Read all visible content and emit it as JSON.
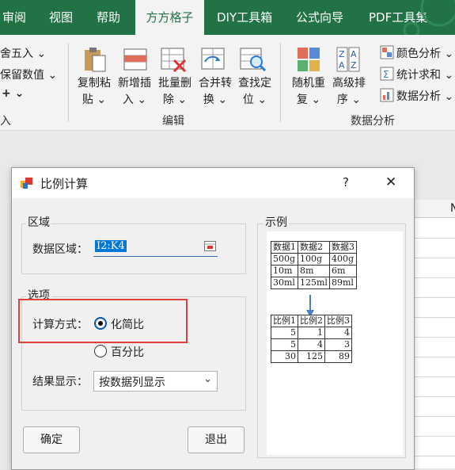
{
  "ribbon_tabs": [
    "审阅",
    "视图",
    "帮助",
    "方方格子",
    "DIY工具箱",
    "公式向导",
    "PDF工具集"
  ],
  "active_tab": "方方格子",
  "ribbon_left": {
    "row1": "舍五入",
    "row2": "保留数值",
    "row3": "+",
    "group": "入"
  },
  "edit_group": {
    "name": "编辑",
    "buttons": [
      {
        "l1": "复制粘",
        "l2": "贴"
      },
      {
        "l1": "新增插",
        "l2": "入"
      },
      {
        "l1": "批量删",
        "l2": "除"
      },
      {
        "l1": "合并转",
        "l2": "换"
      },
      {
        "l1": "查找定",
        "l2": "位"
      }
    ]
  },
  "analysis_group": {
    "name": "数据分析",
    "buttons": [
      {
        "l1": "随机重",
        "l2": "复"
      },
      {
        "l1": "高级排",
        "l2": "序"
      }
    ],
    "small_buttons": [
      "颜色分析",
      "统计求和",
      "数据分析"
    ]
  },
  "sheet": {
    "col_partial": "N"
  },
  "dialog": {
    "title": "比例计算",
    "help": "?",
    "close": "✕",
    "region_group": "区域",
    "data_region_label": "数据区域：",
    "data_region_value": "I2:K4",
    "options_group": "选项",
    "calc_method_label": "计算方式：",
    "option1": "化简比",
    "option2": "百分比",
    "option1_checked": true,
    "result_label": "结果显示：",
    "result_value": "按数据列显示",
    "example_group": "示例",
    "ok": "确定",
    "exit": "退出"
  },
  "example": {
    "top_header": [
      "数据1",
      "数据2",
      "数据3"
    ],
    "top_rows": [
      [
        "500g",
        "100g",
        "400g"
      ],
      [
        "10m",
        "8m",
        "6m"
      ],
      [
        "30ml",
        "125ml",
        "89ml"
      ]
    ],
    "bottom_header": [
      "比例1",
      "比例2",
      "比例3"
    ],
    "bottom_rows": [
      [
        "5",
        "1",
        "4"
      ],
      [
        "5",
        "4",
        "3"
      ],
      [
        "30",
        "125",
        "89"
      ]
    ]
  },
  "colors": {
    "excel_green": "#217346",
    "highlight_red": "#e0403a",
    "selection_blue": "#0078d7"
  }
}
